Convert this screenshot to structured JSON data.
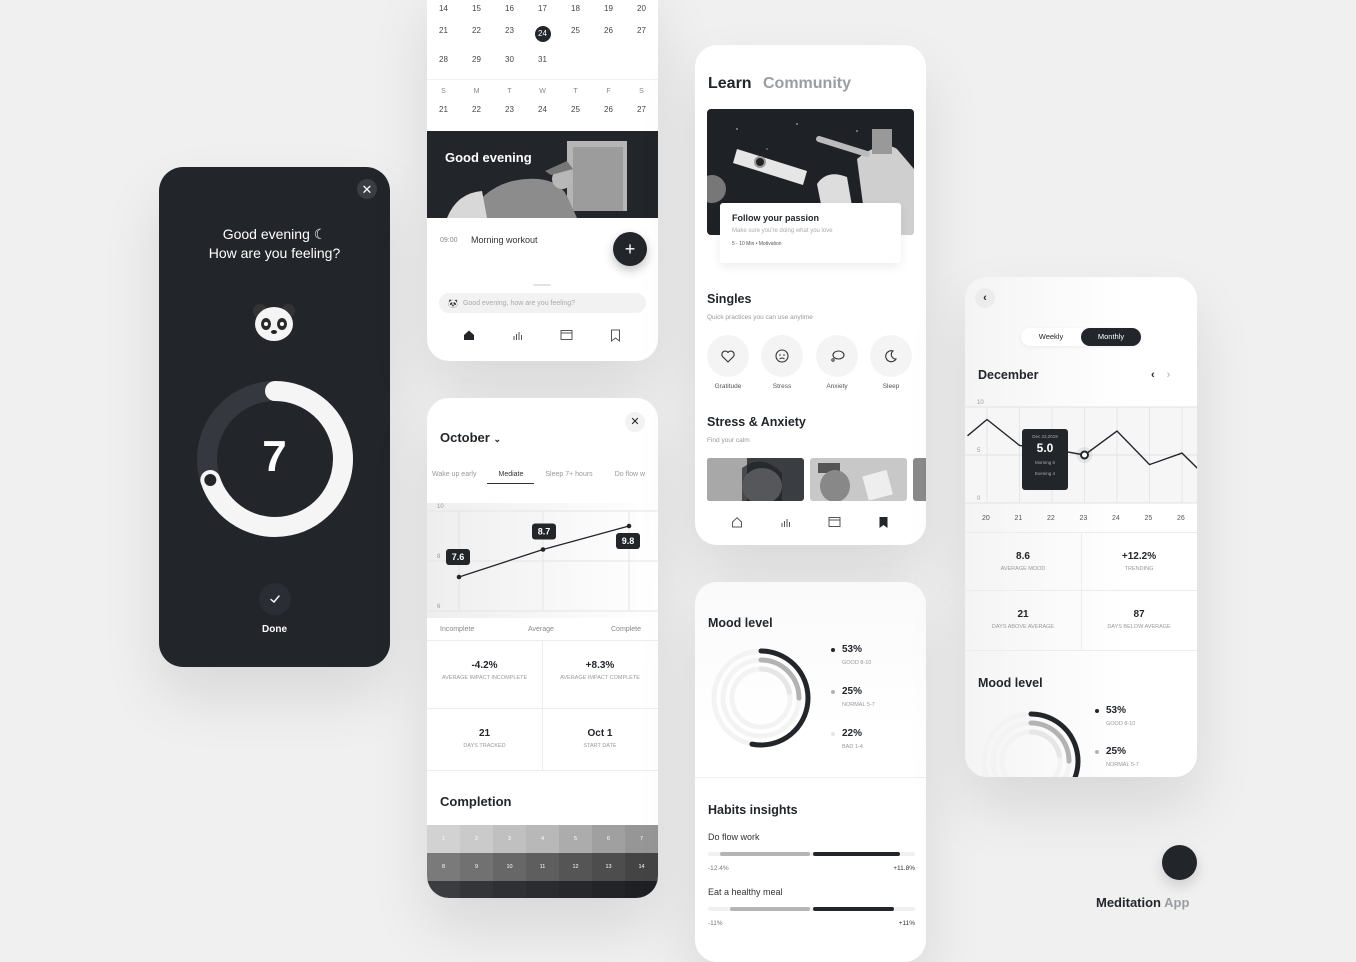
{
  "brand": {
    "name": "Meditation",
    "suffix": "App"
  },
  "feeling_modal": {
    "close_icon": "close-icon",
    "greeting": "Good evening ☾",
    "question": "How are you feeling?",
    "emoji": "panda-face",
    "mood_value": "7",
    "mood_scale_max": 10,
    "mood_fraction": 0.7,
    "done_label": "Done",
    "done_icon": "check-icon"
  },
  "calendar": {
    "month_rows": [
      [
        "14",
        "15",
        "16",
        "17",
        "18",
        "19",
        "20"
      ],
      [
        "21",
        "22",
        "23",
        "24",
        "25",
        "26",
        "27"
      ],
      [
        "28",
        "29",
        "30",
        "31",
        "",
        "",
        ""
      ]
    ],
    "selected_day": "24",
    "week_headers": [
      "S",
      "M",
      "T",
      "W",
      "T",
      "F",
      "S"
    ],
    "week_days": [
      "21",
      "22",
      "23",
      "24",
      "25",
      "26",
      "27"
    ],
    "week_progress": [
      1.0,
      0,
      0.6,
      0.4,
      0,
      0,
      0
    ],
    "hero_title": "Good evening",
    "task": {
      "time": "09:00",
      "name": "Morning workout"
    },
    "add_icon": "plus-icon",
    "prompt_placeholder": "Good evening, how are you feeling?",
    "nav": [
      "home-icon",
      "stats-icon",
      "calendar-icon",
      "bookmark-icon"
    ],
    "nav_active": 0
  },
  "october": {
    "title": "October",
    "tabs": [
      "Wake up early",
      "Mediate",
      "Sleep 7+ hours",
      "Do flow w"
    ],
    "active_tab": 1,
    "chart_data": {
      "type": "line",
      "categories": [
        "Incomplete",
        "Average",
        "Complete"
      ],
      "values": [
        7.6,
        8.7,
        9.8
      ],
      "yticks": [
        "10",
        "8",
        "6"
      ],
      "ylim": [
        6,
        10
      ]
    },
    "stats": [
      {
        "value": "-4.2%",
        "label": "Average impact incomplete"
      },
      {
        "value": "+8.3%",
        "label": "Average impact complete"
      },
      {
        "value": "21",
        "label": "Days tracked"
      },
      {
        "value": "Oct 1",
        "label": "Start date"
      }
    ],
    "completion_title": "Completion",
    "completion_days": [
      "1",
      "2",
      "3",
      "4",
      "5",
      "6",
      "7",
      "8",
      "9",
      "10",
      "11",
      "12",
      "13",
      "14"
    ]
  },
  "learn": {
    "tabs": [
      "Learn",
      "Community"
    ],
    "featured": {
      "title": "Follow your passion",
      "subtitle": "Make sure you're doing what you love",
      "meta": "5 - 10 Min  •  Motivation"
    },
    "singles_title": "Singles",
    "singles_sub": "Quick practices you can use anytime",
    "singles": [
      {
        "label": "Gratitude",
        "icon": "heart-icon"
      },
      {
        "label": "Stress",
        "icon": "sad-face-icon"
      },
      {
        "label": "Anxiety",
        "icon": "thought-bubble-icon"
      },
      {
        "label": "Sleep",
        "icon": "moon-icon"
      }
    ],
    "stress_title": "Stress & Anxiety",
    "stress_sub": "Find your calm",
    "nav": [
      "home-icon",
      "stats-icon",
      "calendar-icon",
      "bookmark-icon"
    ],
    "nav_active": 3
  },
  "mood": {
    "title": "Mood level",
    "chart_data": {
      "type": "pie",
      "categories": [
        "Good 8-10",
        "Normal 5-7",
        "Bad 1-4"
      ],
      "values": [
        53,
        25,
        22
      ]
    },
    "legend": [
      {
        "pct": "53%",
        "label": "GOOD 8-10",
        "color": "#22262b"
      },
      {
        "pct": "25%",
        "label": "NORMAL 5-7",
        "color": "#b3b3b3"
      },
      {
        "pct": "22%",
        "label": "BAD 1-4",
        "color": "#e6e6e6"
      }
    ],
    "habits_title": "Habits insights",
    "habits": [
      {
        "name": "Do flow work",
        "neg": "-12.4%",
        "pos": "+11.8%",
        "neg_val": 12.4,
        "pos_val": 11.8
      },
      {
        "name": "Eat a healthy meal",
        "neg": "-11%",
        "pos": "+11%",
        "neg_val": 11,
        "pos_val": 11
      }
    ]
  },
  "december": {
    "toggle": [
      "Weekly",
      "Monthly"
    ],
    "toggle_active": 1,
    "month": "December",
    "chart_data": {
      "type": "line",
      "x": [
        "20",
        "21",
        "22",
        "23",
        "24",
        "25",
        "26"
      ],
      "values": [
        8.7,
        8.0,
        6.0,
        5.0,
        7.5,
        4.0,
        5.2,
        3.2
      ],
      "x_extended": [
        "19.4",
        "20",
        "21",
        "22",
        "23",
        "24",
        "25",
        "26",
        "26.6"
      ],
      "yticks": [
        "10",
        "5",
        "0"
      ],
      "ylim": [
        0,
        10
      ]
    },
    "line_points": [
      [
        19.4,
        7.0
      ],
      [
        20,
        8.7
      ],
      [
        21,
        6.0
      ],
      [
        22,
        5.6
      ],
      [
        23,
        5.0
      ],
      [
        24,
        7.5
      ],
      [
        25,
        4.0
      ],
      [
        26,
        5.2
      ],
      [
        26.6,
        3.2
      ]
    ],
    "tooltip": {
      "date": "Dec 23,2019",
      "value": "5.0",
      "morning": "Morning 6",
      "evening": "Evening 4",
      "x": 23
    },
    "stats": [
      {
        "value": "8.6",
        "label": "Average mood"
      },
      {
        "value": "+12.2%",
        "label": "Trending"
      },
      {
        "value": "21",
        "label": "Days above average"
      },
      {
        "value": "87",
        "label": "Days below average"
      }
    ],
    "mood_title": "Mood level",
    "legend": [
      {
        "pct": "53%",
        "label": "GOOD 8-10",
        "color": "#22262b"
      },
      {
        "pct": "25%",
        "label": "NORMAL 5-7",
        "color": "#b3b3b3"
      }
    ]
  }
}
